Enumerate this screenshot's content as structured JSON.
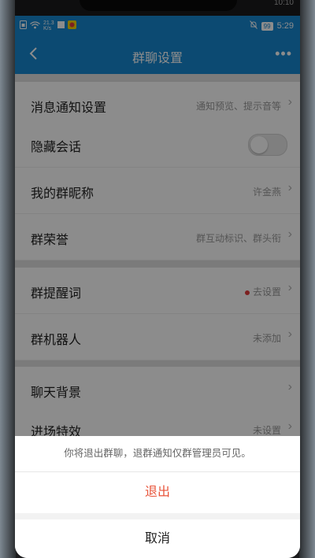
{
  "statusbar": {
    "left_speed": "21.3\nK/s",
    "battery": "99",
    "time": "5:29",
    "frame_time": "10:10"
  },
  "navbar": {
    "title": "群聊设置",
    "more": "•••"
  },
  "settings": {
    "message_notify": {
      "label": "消息通知设置",
      "value": "通知预览、提示音等"
    },
    "hide_chat": {
      "label": "隐藏会话"
    },
    "my_nickname": {
      "label": "我的群昵称",
      "value": "许金燕"
    },
    "group_honor": {
      "label": "群荣誉",
      "value": "群互动标识、群头衔"
    },
    "group_reminder": {
      "label": "群提醒词",
      "value": "去设置"
    },
    "group_robot": {
      "label": "群机器人",
      "value": "未添加"
    },
    "chat_background": {
      "label": "聊天背景"
    },
    "entry_effect": {
      "label": "进场特效",
      "value": "未设置"
    }
  },
  "sheet": {
    "message": "你将退出群聊，退群通知仅群管理员可见。",
    "exit_label": "退出",
    "cancel_label": "取消"
  },
  "colors": {
    "accent": "#1787cf",
    "danger": "#e8543a"
  }
}
